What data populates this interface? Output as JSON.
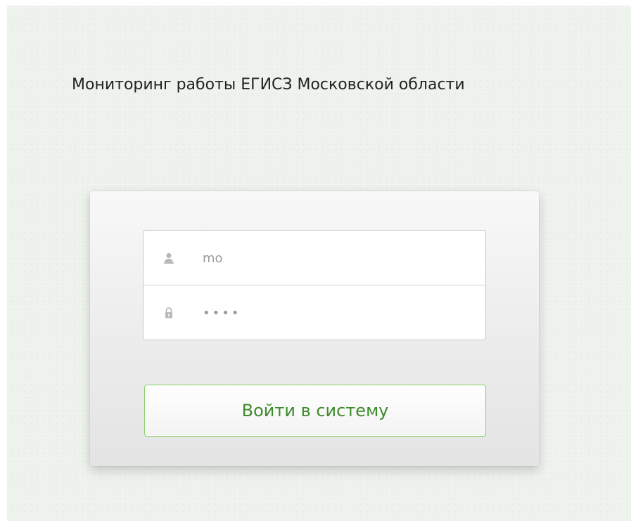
{
  "header": {
    "title": "Мониторинг работы ЕГИСЗ Московской области"
  },
  "login_form": {
    "username": {
      "icon": "user-icon",
      "value": "mo"
    },
    "password": {
      "icon": "lock-icon",
      "value": "••••"
    },
    "submit_label": "Войти в систему"
  },
  "colors": {
    "page_background": "#eef2ec",
    "button_text": "#3f8a2c",
    "button_border": "#8bd068"
  }
}
